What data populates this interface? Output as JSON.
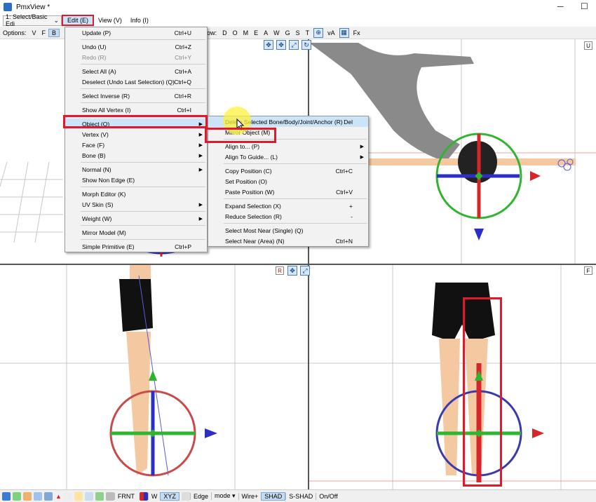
{
  "window": {
    "title": "PmxView *",
    "minimize": "─",
    "maximize": "☐"
  },
  "menubar": {
    "mode_select": "1: Select/Basic Edi",
    "items": [
      "Edit (E)",
      "View (V)",
      "Info (I)"
    ]
  },
  "toolbar": {
    "options_label": "Options:",
    "options": [
      "V",
      "F",
      "B"
    ],
    "show_label": "ow:",
    "show_items": [
      "D",
      "O",
      "M",
      "E",
      "A",
      "W",
      "G",
      "S",
      "T"
    ],
    "va_label": "vA",
    "fx_label": "Fx"
  },
  "viewport_labels": {
    "top_right": "U",
    "bottom_left": "R",
    "bottom_right": "F"
  },
  "edit_menu": [
    {
      "label": "Update (P)",
      "shortcut": "Ctrl+U"
    },
    {
      "sep": true
    },
    {
      "label": "Undo (U)",
      "shortcut": "Ctrl+Z"
    },
    {
      "label": "Redo (R)",
      "shortcut": "Ctrl+Y",
      "disabled": true
    },
    {
      "sep": true
    },
    {
      "label": "Select All (A)",
      "shortcut": "Ctrl+A"
    },
    {
      "label": "Deselect (Undo Last Selection) (Q)",
      "shortcut": "Ctrl+Q"
    },
    {
      "sep": true
    },
    {
      "label": "Select Inverse (R)",
      "shortcut": "Ctrl+R"
    },
    {
      "sep": true
    },
    {
      "label": "Show All Vertex (I)",
      "shortcut": "Ctrl+I"
    },
    {
      "sep": true
    },
    {
      "label": "Object (O)",
      "submenu": true,
      "highlighted": true
    },
    {
      "label": "Vertex (V)",
      "submenu": true
    },
    {
      "label": "Face (F)",
      "submenu": true
    },
    {
      "label": "Bone (B)",
      "submenu": true
    },
    {
      "sep": true
    },
    {
      "label": "Normal (N)",
      "submenu": true
    },
    {
      "label": "Show Non Edge (E)"
    },
    {
      "sep": true
    },
    {
      "label": "Morph Editor (K)"
    },
    {
      "label": "UV Skin (S)",
      "submenu": true
    },
    {
      "sep": true
    },
    {
      "label": "Weight (W)",
      "submenu": true
    },
    {
      "sep": true
    },
    {
      "label": "Mirror Model (M)"
    },
    {
      "sep": true
    },
    {
      "label": "Simple Primitive (E)",
      "shortcut": "Ctrl+P"
    }
  ],
  "object_submenu": [
    {
      "label": "Delete Selected Bone/Body/Joint/Anchor (R)",
      "shortcut": "Del",
      "highlighted": true
    },
    {
      "label": "Mirror Object (M)"
    },
    {
      "sep": true
    },
    {
      "label": "Align to... (P)",
      "submenu": true
    },
    {
      "label": "Align To Guide... (L)",
      "submenu": true
    },
    {
      "sep": true
    },
    {
      "label": "Copy Position (C)",
      "shortcut": "Ctrl+C"
    },
    {
      "label": "Set Position (O)"
    },
    {
      "label": "Paste Position (W)",
      "shortcut": "Ctrl+V"
    },
    {
      "sep": true
    },
    {
      "label": "Expand Selection (X)",
      "shortcut": "+"
    },
    {
      "label": "Reduce Selection (R)",
      "shortcut": "-"
    },
    {
      "sep": true
    },
    {
      "label": "Select Most Near (Single) (Q)"
    },
    {
      "label": "Select Near (Area) (N)",
      "shortcut": "Ctrl+N"
    }
  ],
  "statusbar": {
    "items": [
      "FRNT",
      "W",
      "XYZ",
      "Edge",
      "mode ▾",
      "Wire+",
      "SHAD",
      "S-SHAD",
      "On/Off"
    ]
  },
  "colors": {
    "highlight_box": "#e3182d",
    "menu_hover": "#cce4f7",
    "gizmo_red": "#d7262b",
    "gizmo_green": "#2fb52f",
    "gizmo_blue": "#2b2fc4"
  }
}
